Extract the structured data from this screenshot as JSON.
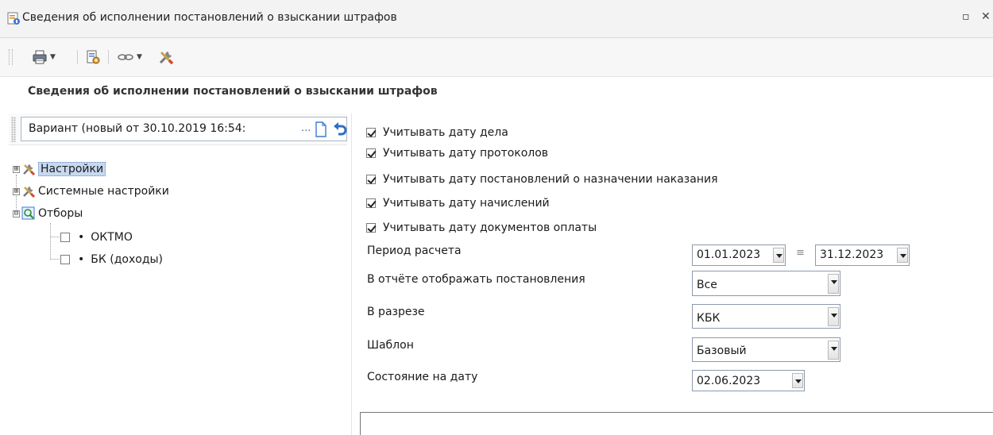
{
  "window": {
    "title": "Сведения об исполнении постановлений о взыскании штрафов",
    "icon": "report-app-icon",
    "restore_glyph": "▫",
    "close_glyph": "✕"
  },
  "toolbar": {
    "items": [
      "print-icon",
      "report-settings-icon",
      "link-icon",
      "tools-icon"
    ]
  },
  "page": {
    "heading": "Сведения об исполнении постановлений о взыскании штрафов"
  },
  "variant": {
    "value": "Вариант (новый от 30.10.2019 16:54:",
    "ellipsis": "..."
  },
  "tree": {
    "items": [
      {
        "label": "Настройки",
        "expander": "⊞",
        "selected": true
      },
      {
        "label": "Системные настройки",
        "expander": "⊞"
      },
      {
        "label": "Отборы",
        "expander": "⊟"
      },
      {
        "label": "ОКТМО",
        "bullet": "•",
        "checked": false
      },
      {
        "label": "БК (доходы)",
        "bullet": "•",
        "checked": false
      }
    ]
  },
  "options": [
    {
      "label": "Учитывать дату дела",
      "checked": true
    },
    {
      "label": "Учитывать дату протоколов",
      "checked": true
    },
    {
      "label": "Учитывать дату постановлений о назначении наказания",
      "checked": true
    },
    {
      "label": "Учитывать дату начислений",
      "checked": true
    },
    {
      "label": "Учитывать дату документов оплаты",
      "checked": true
    }
  ],
  "params": {
    "period": {
      "label": "Период расчета",
      "from": "01.01.2023",
      "to": "31.12.2023"
    },
    "show": {
      "label": "В отчёте отображать постановления",
      "value": "Все"
    },
    "section": {
      "label": "В разрезе",
      "value": "КБК"
    },
    "template": {
      "label": "Шаблон",
      "value": "Базовый"
    },
    "state_date": {
      "label": "Состояние на дату",
      "value": "02.06.2023"
    }
  },
  "colors": {
    "selected_bg": "#c7d9f0",
    "field_border": "#a9b6c6",
    "accent": "#2f6fc1"
  }
}
